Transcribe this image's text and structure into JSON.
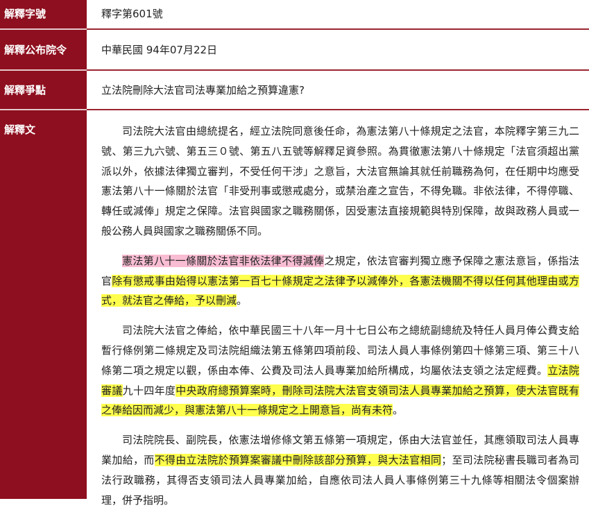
{
  "rows": {
    "number": {
      "label": "解釋字號",
      "value": "釋字第601號"
    },
    "date": {
      "label": "解釋公布院令",
      "value": "中華民國 94年07月22日"
    },
    "issue": {
      "label": "解釋爭點",
      "value": "立法院刪除大法官司法專業加給之預算違憲?"
    },
    "text": {
      "label": "解釋文",
      "p1": "司法院大法官由總統提名，經立法院同意後任命，為憲法第八十條規定之法官，本院釋字第三九二號、第三九六號、第五三０號、第五八五號等解釋足資參照。為貫徹憲法第八十條規定「法官須超出黨派以外，依據法律獨立審判，不受任何干涉」之意旨，大法官無論其就任前職務為何，在任期中均應受憲法第八十一條關於法官「非受刑事或懲戒處分，或禁治產之宣告，不得免職。非依法律，不得停職、轉任或減俸」規定之保障。法官與國家之職務關係，因受憲法直接規範與特別保障，故與政務人員或一般公務人員與國家之職務關係不同。",
      "p2": {
        "s1": "憲法第八十一條關於法官非依法律不得減俸",
        "s2": "之規定，依法官審判獨立應予保障之憲法意旨，係指法官",
        "s3": "除有懲戒事由始得以憲法第一百七十條規定之法律予以減俸外，各憲法機關不得以任何其他理由或方式，就法官之俸給，予以刪減",
        "s4": "。"
      },
      "p3": {
        "s1": "司法院大法官之俸給，依中華民國三十八年一月十七日公布之總統副總統及特任人員月俸公費支給暫行條例第二條規定及司法院組織法第五條第四項前段、司法人員人事條例第四十條第三項、第三十八條第二項之規定以觀，係由本俸、公費及司法人員專業加給所構成，均屬依法支領之法定經費。",
        "s2": "立法院審議",
        "s3": "九十四年度",
        "s4": "中央政府總預算案時，刪除司法院大法官支領司法人員專業加給之預算，使大法官既有之俸給因而減少，與憲法第八十一條規定之上開意旨，尚有未符",
        "s5": "。"
      },
      "p4": {
        "s1": "司法院院長、副院長，依憲法增修條文第五條第一項規定，係由大法官並任，其應領取司法人員專業加給，而",
        "s2": "不得由立法院於預算案審議中刪除該部分預算，與大法官相同",
        "s3": "；至司法院秘書長職司者為司法行政職務，其得否支領司法人員專業加給，自應依司法人員人事條例第三十九條等相關法令個案辦理，併予指明。"
      }
    }
  },
  "colors": {
    "label_bg": "#8e0f1f",
    "separator": "#9a2530",
    "highlight_yellow": "#ffff4d",
    "highlight_pink": "#f9bdd3"
  }
}
